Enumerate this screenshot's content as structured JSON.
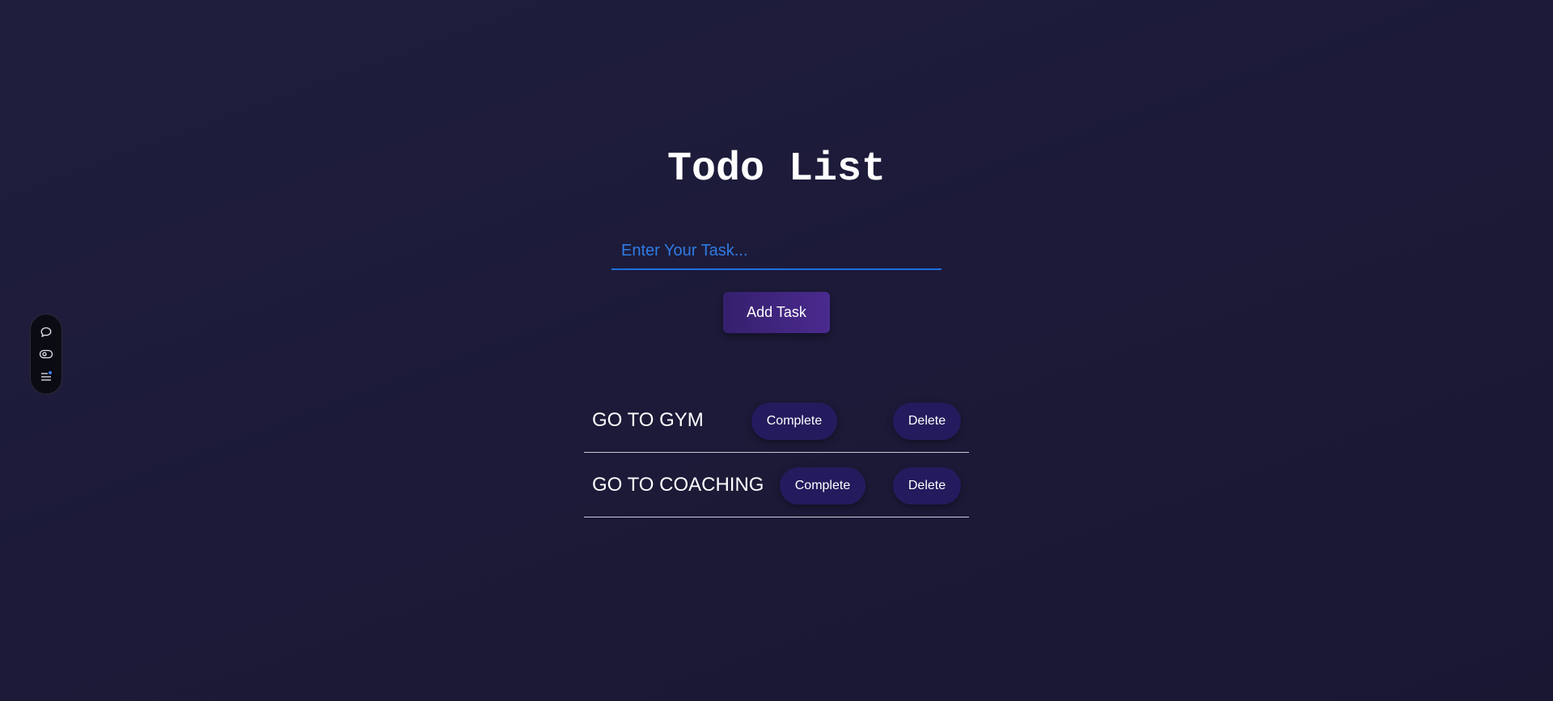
{
  "app": {
    "title": "Todo List"
  },
  "input": {
    "placeholder": "Enter Your Task...",
    "value": ""
  },
  "add_button": {
    "label": "Add Task"
  },
  "tasks": [
    {
      "text": "GO TO GYM",
      "complete_label": "Complete",
      "delete_label": "Delete"
    },
    {
      "text": "GO TO COACHING",
      "complete_label": "Complete",
      "delete_label": "Delete"
    }
  ],
  "dock": {
    "icons": [
      "chat-bubble-icon",
      "eye-toggle-icon",
      "list-menu-icon"
    ]
  },
  "colors": {
    "background": "#1d1b3a",
    "accent_blue": "#1f6fe0",
    "button_purple": "#35206d",
    "pill": "#241b5e",
    "text": "#ffffff"
  }
}
